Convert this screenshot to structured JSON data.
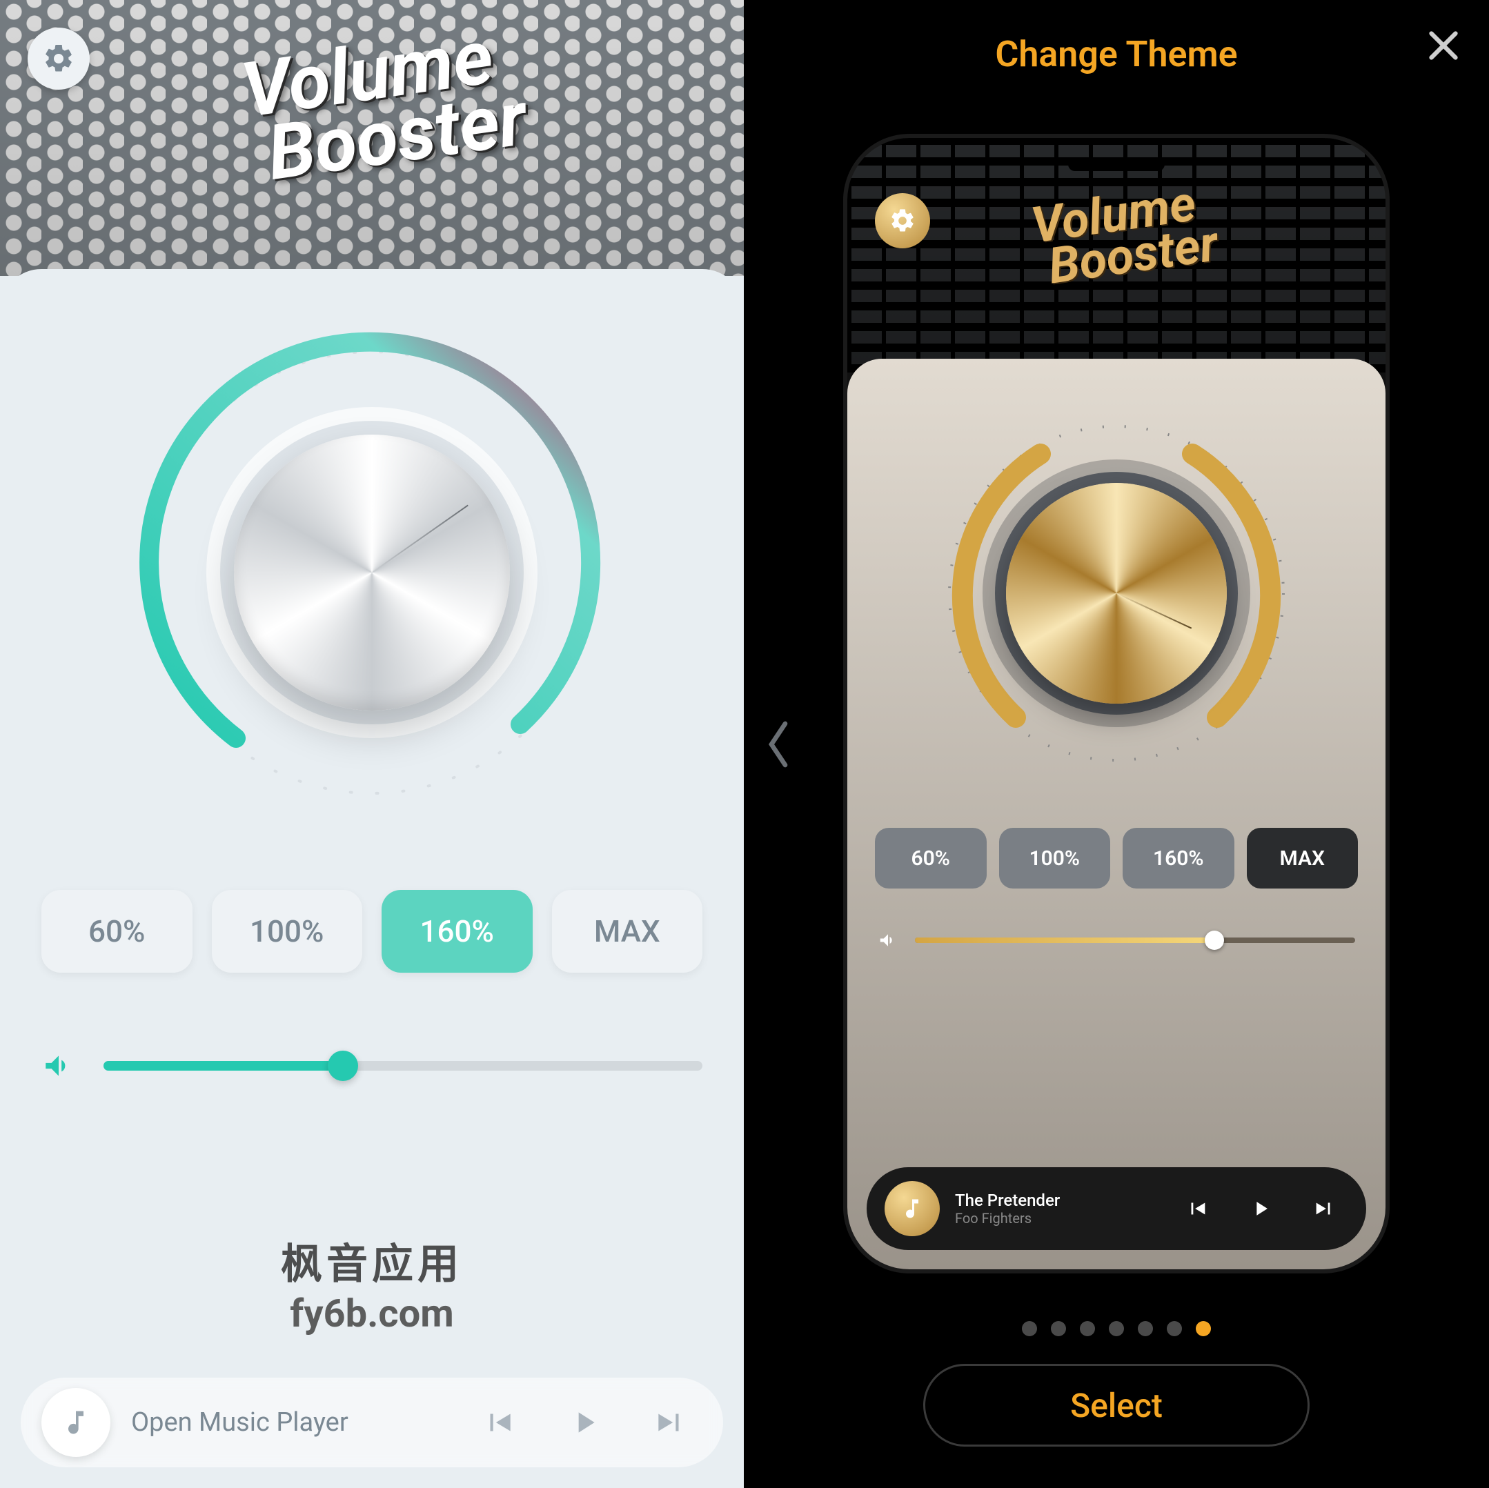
{
  "app": {
    "title_line1": "Volume",
    "title_line2": "Booster"
  },
  "left": {
    "settings_icon": "gear-icon",
    "knob_value_percent": 160,
    "presets": [
      {
        "label": "60%",
        "active": false
      },
      {
        "label": "100%",
        "active": false
      },
      {
        "label": "160%",
        "active": true
      },
      {
        "label": "MAX",
        "active": false
      }
    ],
    "slider_percent": 40,
    "player_open_label": "Open Music Player",
    "watermark_text_cn": "枫音应用",
    "watermark_url": "fy6b.com"
  },
  "right": {
    "title": "Change Theme",
    "close_icon": "close-icon",
    "prev_arrow_icon": "chevron-left-icon",
    "preview": {
      "presets": [
        {
          "label": "60%",
          "style": "grey"
        },
        {
          "label": "100%",
          "style": "grey"
        },
        {
          "label": "160%",
          "style": "grey"
        },
        {
          "label": "MAX",
          "style": "dark"
        }
      ],
      "slider_percent": 68,
      "track_title": "The Pretender",
      "track_artist": "Foo Fighters"
    },
    "dots_count": 7,
    "active_dot_index": 6,
    "select_label": "Select"
  },
  "colors": {
    "accent_teal": "#25c9b0",
    "accent_gold": "#f5a623",
    "gold_metal": "#d4a544"
  }
}
